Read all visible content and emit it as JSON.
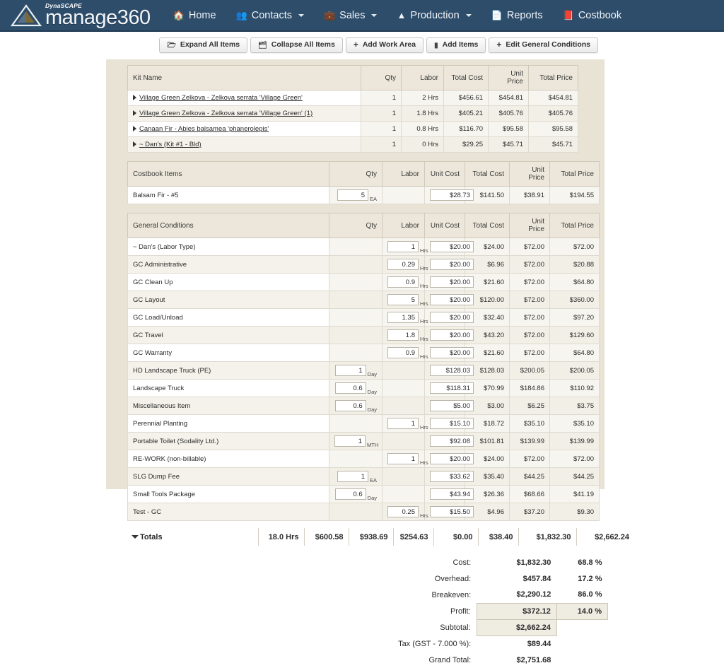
{
  "nav": {
    "brand_sup": "DynaSCAPE",
    "brand": "manage360",
    "items": [
      {
        "label": "Home",
        "icon": "home-icon",
        "glyph": "🏠",
        "caret": false
      },
      {
        "label": "Contacts",
        "icon": "people-icon",
        "glyph": "👥",
        "caret": true
      },
      {
        "label": "Sales",
        "icon": "briefcase-icon",
        "glyph": "💼",
        "caret": true
      },
      {
        "label": "Production",
        "icon": "production-icon",
        "glyph": "Ⓐ",
        "caret": true
      },
      {
        "label": "Reports",
        "icon": "document-icon",
        "glyph": "📄",
        "caret": false
      },
      {
        "label": "Costbook",
        "icon": "book-icon",
        "glyph": "📕",
        "caret": false
      }
    ]
  },
  "toolbar": {
    "buttons": [
      {
        "label": "Expand All Items",
        "icon": "expand-folder-icon",
        "glyph": "🗁",
        "plus": false
      },
      {
        "label": "Collapse All Items",
        "icon": "collapse-folder-icon",
        "glyph": "🗂",
        "plus": false
      },
      {
        "label": "Add Work Area",
        "icon": "plus-icon",
        "glyph": "+",
        "plus": true
      },
      {
        "label": "Add Items",
        "icon": "list-icon",
        "glyph": "▮",
        "plus": false
      },
      {
        "label": "Edit General Conditions",
        "icon": "plus-icon",
        "glyph": "+",
        "plus": true
      }
    ]
  },
  "kits": {
    "headers": [
      "Kit Name",
      "Qty",
      "Labor",
      "Total Cost",
      "Unit Price",
      "Total Price"
    ],
    "rows": [
      {
        "name": "Village Green Zelkova - Zelkova serrata 'Village Green'",
        "qty": "1",
        "labor": "2 Hrs",
        "total_cost": "$456.61",
        "unit_price": "$454.81",
        "total_price": "$454.81"
      },
      {
        "name": "Village Green Zelkova - Zelkova serrata 'Village Green' (1)",
        "qty": "1",
        "labor": "1.8 Hrs",
        "total_cost": "$405.21",
        "unit_price": "$405.76",
        "total_price": "$405.76"
      },
      {
        "name": "Canaan Fir - Abies balsamea 'phanerolepis'",
        "qty": "1",
        "labor": "0.8 Hrs",
        "total_cost": "$116.70",
        "unit_price": "$95.58",
        "total_price": "$95.58"
      },
      {
        "name": "~ Dan's (Kit #1 - Bld)",
        "qty": "1",
        "labor": "0 Hrs",
        "total_cost": "$29.25",
        "unit_price": "$45.71",
        "total_price": "$45.71"
      }
    ]
  },
  "costbook": {
    "headers": [
      "Costbook Items",
      "Qty",
      "Labor",
      "Unit Cost",
      "Total Cost",
      "Unit Price",
      "Total Price"
    ],
    "rows": [
      {
        "name": "Balsam Fir - #5",
        "qty": "5",
        "qty_unit": "EA",
        "labor": "",
        "labor_unit": "",
        "unit_cost": "$28.73",
        "total_cost": "$141.50",
        "unit_price": "$38.91",
        "total_price": "$194.55"
      }
    ]
  },
  "general_conditions": {
    "headers": [
      "General Conditions",
      "Qty",
      "Labor",
      "Unit Cost",
      "Total Cost",
      "Unit Price",
      "Total Price"
    ],
    "rows": [
      {
        "name": "~ Dan's (Labor Type)",
        "qty": "",
        "qty_unit": "",
        "labor": "1",
        "labor_unit": "Hrs",
        "unit_cost": "$20.00",
        "total_cost": "$24.00",
        "unit_price": "$72.00",
        "total_price": "$72.00"
      },
      {
        "name": "GC Administrative",
        "qty": "",
        "qty_unit": "",
        "labor": "0.29",
        "labor_unit": "Hrs",
        "unit_cost": "$20.00",
        "total_cost": "$6.96",
        "unit_price": "$72.00",
        "total_price": "$20.88"
      },
      {
        "name": "GC Clean Up",
        "qty": "",
        "qty_unit": "",
        "labor": "0.9",
        "labor_unit": "Hrs",
        "unit_cost": "$20.00",
        "total_cost": "$21.60",
        "unit_price": "$72.00",
        "total_price": "$64.80"
      },
      {
        "name": "GC Layout",
        "qty": "",
        "qty_unit": "",
        "labor": "5",
        "labor_unit": "Hrs",
        "unit_cost": "$20.00",
        "total_cost": "$120.00",
        "unit_price": "$72.00",
        "total_price": "$360.00"
      },
      {
        "name": "GC Load/Unload",
        "qty": "",
        "qty_unit": "",
        "labor": "1.35",
        "labor_unit": "Hrs",
        "unit_cost": "$20.00",
        "total_cost": "$32.40",
        "unit_price": "$72.00",
        "total_price": "$97.20"
      },
      {
        "name": "GC Travel",
        "qty": "",
        "qty_unit": "",
        "labor": "1.8",
        "labor_unit": "Hrs",
        "unit_cost": "$20.00",
        "total_cost": "$43.20",
        "unit_price": "$72.00",
        "total_price": "$129.60"
      },
      {
        "name": "GC Warranty",
        "qty": "",
        "qty_unit": "",
        "labor": "0.9",
        "labor_unit": "Hrs",
        "unit_cost": "$20.00",
        "total_cost": "$21.60",
        "unit_price": "$72.00",
        "total_price": "$64.80"
      },
      {
        "name": "HD Landscape Truck (PE)",
        "qty": "1",
        "qty_unit": "Day",
        "labor": "",
        "labor_unit": "",
        "unit_cost": "$128.03",
        "total_cost": "$128.03",
        "unit_price": "$200.05",
        "total_price": "$200.05"
      },
      {
        "name": "Landscape Truck",
        "qty": "0.6",
        "qty_unit": "Day",
        "labor": "",
        "labor_unit": "",
        "unit_cost": "$118.31",
        "total_cost": "$70.99",
        "unit_price": "$184.86",
        "total_price": "$110.92"
      },
      {
        "name": "Miscellaneous Item",
        "qty": "0.6",
        "qty_unit": "Day",
        "labor": "",
        "labor_unit": "",
        "unit_cost": "$5.00",
        "total_cost": "$3.00",
        "unit_price": "$6.25",
        "total_price": "$3.75"
      },
      {
        "name": "Perennial Planting",
        "qty": "",
        "qty_unit": "",
        "labor": "1",
        "labor_unit": "Hrs",
        "unit_cost": "$15.10",
        "total_cost": "$18.72",
        "unit_price": "$35.10",
        "total_price": "$35.10"
      },
      {
        "name": "Portable Toilet (Sodality Ltd.)",
        "qty": "1",
        "qty_unit": "MTH",
        "labor": "",
        "labor_unit": "",
        "unit_cost": "$92.08",
        "total_cost": "$101.81",
        "unit_price": "$139.99",
        "total_price": "$139.99"
      },
      {
        "name": "RE-WORK (non-billable)",
        "qty": "",
        "qty_unit": "",
        "labor": "1",
        "labor_unit": "Hrs",
        "unit_cost": "$20.00",
        "total_cost": "$24.00",
        "unit_price": "$72.00",
        "total_price": "$72.00"
      },
      {
        "name": "SLG Dump Fee",
        "qty": "1",
        "qty_unit": "EA",
        "labor": "",
        "labor_unit": "",
        "unit_cost": "$33.62",
        "total_cost": "$35.40",
        "unit_price": "$44.25",
        "total_price": "$44.25"
      },
      {
        "name": "Small Tools Package",
        "qty": "0.6",
        "qty_unit": "Day",
        "labor": "",
        "labor_unit": "",
        "unit_cost": "$43.94",
        "total_cost": "$26.36",
        "unit_price": "$68.66",
        "total_price": "$41.19"
      },
      {
        "name": "Test - GC",
        "qty": "",
        "qty_unit": "",
        "labor": "0.25",
        "labor_unit": "Hrs",
        "unit_cost": "$15.50",
        "total_cost": "$4.96",
        "unit_price": "$37.20",
        "total_price": "$9.30"
      }
    ]
  },
  "totals": {
    "label": "Totals",
    "values": [
      "18.0 Hrs",
      "$600.58",
      "$938.69",
      "$254.63",
      "$0.00",
      "$38.40",
      "$1,832.30",
      "$2,662.24"
    ]
  },
  "summary": {
    "rows": [
      {
        "label": "Cost:",
        "value": "$1,832.30",
        "pct": "68.8 %",
        "boxed": false,
        "pct_boxed": false
      },
      {
        "label": "Overhead:",
        "value": "$457.84",
        "pct": "17.2 %",
        "boxed": false,
        "pct_boxed": false
      },
      {
        "label": "Breakeven:",
        "value": "$2,290.12",
        "pct": "86.0 %",
        "boxed": false,
        "pct_boxed": false
      },
      {
        "label": "Profit:",
        "value": "$372.12",
        "pct": "14.0 %",
        "boxed": true,
        "pct_boxed": true
      },
      {
        "label": "Subtotal:",
        "value": "$2,662.24",
        "pct": "",
        "boxed": true,
        "pct_boxed": false
      },
      {
        "label": "Tax (GST - 7.000 %):",
        "value": "$89.44",
        "pct": "",
        "boxed": false,
        "pct_boxed": false
      },
      {
        "label": "Grand Total:",
        "value": "$2,751.68",
        "pct": "",
        "boxed": false,
        "pct_boxed": false
      }
    ]
  },
  "colors": {
    "navbar": "#2d4d6b",
    "panel": "#e8e3d5",
    "header_row": "#ece7da"
  }
}
